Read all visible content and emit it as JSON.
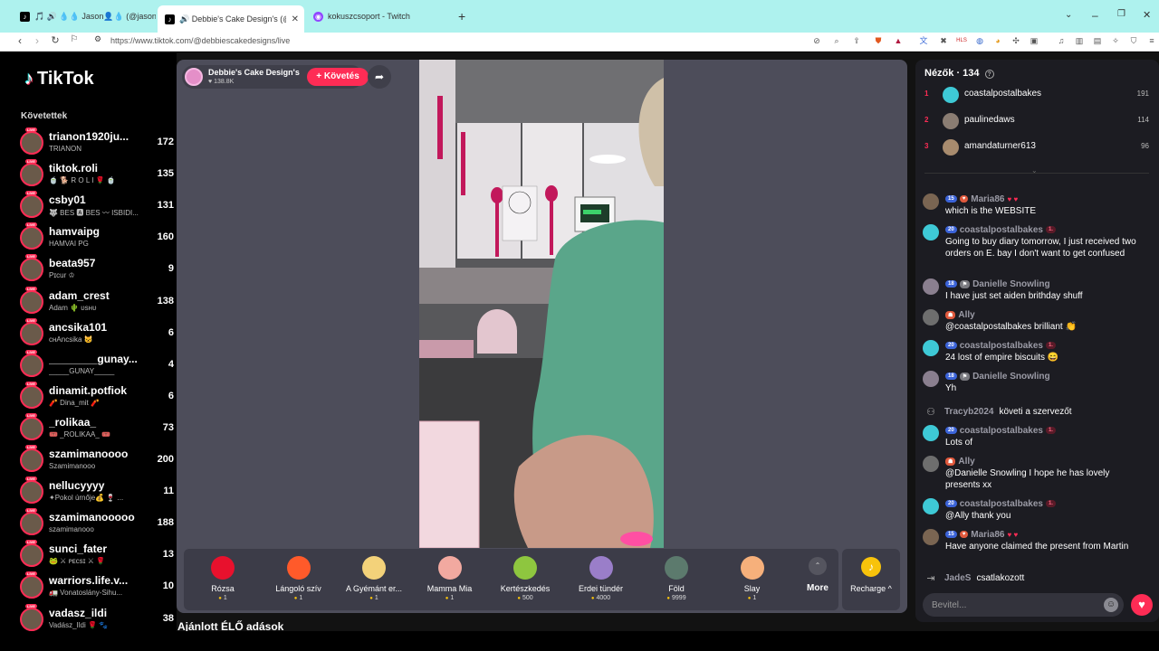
{
  "browser": {
    "tabs": [
      {
        "title": "🎵 🔊 💧💧 Jason👤💧 (@jason_san",
        "color": "#000"
      },
      {
        "title": "🔊 Debbie's Cake Design's (@de",
        "color": "#000"
      },
      {
        "title": "kokuszcsoport - Twitch",
        "color": "#9146ff"
      }
    ],
    "new_tab": "+",
    "url": "https://www.tiktok.com/@debbiescakedesigns/live"
  },
  "sidebar": {
    "logo": "TikTok",
    "following_title": "Követettek",
    "live_badge": "LIVE",
    "items": [
      {
        "name": "trianon1920ju...",
        "sub": "TRIANON",
        "count": "172"
      },
      {
        "name": "tiktok.roli",
        "sub": "🍵 🐕 R O L I 🌹 🍵",
        "count": "135"
      },
      {
        "name": "csby01",
        "sub": "🐺 BES 🅰 BES 〰 ISBIDI...",
        "count": "131"
      },
      {
        "name": "hamvaipg",
        "sub": "HAMVAI PG",
        "count": "160"
      },
      {
        "name": "beata957",
        "sub": "Pɪcur ♔",
        "count": "9"
      },
      {
        "name": "adam_crest",
        "sub": "Adam 🌵 ᴜsʜᴜ",
        "count": "138"
      },
      {
        "name": "ancsika101",
        "sub": "ᴄʜAncsika 😺",
        "count": "6"
      },
      {
        "name": "________gunay...",
        "sub": "_____GUNAY_____",
        "count": "4"
      },
      {
        "name": "dinamit.potfiok",
        "sub": "🧨 Dina_mit 🧨",
        "count": "6"
      },
      {
        "name": "_rolikaa_",
        "sub": "🎟️ _ROLIKAA_ 🎟️",
        "count": "73"
      },
      {
        "name": "szamimanoooo",
        "sub": "Szamimanooo",
        "count": "200"
      },
      {
        "name": "nellucyyyy",
        "sub": "✦Pokol úrnője💰 🍷 ...",
        "count": "11"
      },
      {
        "name": "szamimanooooo",
        "sub": "szamimanooo",
        "count": "188"
      },
      {
        "name": "sunci_fater",
        "sub": "🐸 ⚔ ᴘᴇᴄsɪ ⚔ 🌹",
        "count": "13"
      },
      {
        "name": "warriors.life.v...",
        "sub": "🚛 Vonatoslány-Sihu...",
        "count": "10"
      },
      {
        "name": "vadasz_ildi",
        "sub": "Vadász_Ildi 🌹 🐾",
        "count": "38"
      }
    ]
  },
  "stream": {
    "host_name": "Debbie's Cake Design's",
    "likes": "♥ 138.8K",
    "follow_label": "+ Követés",
    "gifts": [
      {
        "name": "Rózsa",
        "price": "1",
        "color": "#e8112d"
      },
      {
        "name": "Lángoló szív",
        "price": "1",
        "color": "#ff5a2a"
      },
      {
        "name": "A Gyémánt er...",
        "price": "1",
        "color": "#f3d27a"
      },
      {
        "name": "Mamma Mia",
        "price": "1",
        "color": "#f2a9a0"
      },
      {
        "name": "Kertészkedés",
        "price": "500",
        "color": "#8ec63f"
      },
      {
        "name": "Erdei tündér",
        "price": "4000",
        "color": "#9a7ec9"
      },
      {
        "name": "Föld",
        "price": "9999",
        "color": "#5c7a6d"
      },
      {
        "name": "Slay",
        "price": "1",
        "color": "#f6b07b"
      }
    ],
    "more_label": "More",
    "recharge_label": "Recharge ^",
    "recommended_title": "Ajánlott ÉLŐ adások"
  },
  "viewers": {
    "title": "Nézők · 134",
    "top": [
      {
        "rank": "1",
        "name": "coastalpostalbakes",
        "score": "191",
        "color": "#3ec9d6"
      },
      {
        "rank": "2",
        "name": "paulinedaws",
        "score": "114",
        "color": "#8b7d73"
      },
      {
        "rank": "3",
        "name": "amandaturner613",
        "score": "96",
        "color": "#a88b6e"
      }
    ]
  },
  "chat": {
    "messages": [
      {
        "user": "Maria86",
        "level": "15",
        "text": "which is the WEBSITE",
        "color": "#7a6552",
        "badge_type": "heart"
      },
      {
        "user": "coastalpostalbakes",
        "level": "20",
        "text": "Going to buy diary tomorrow, I just received two orders on E. bay I don't want to get confused",
        "color": "#3ec9d6",
        "rank": "1."
      },
      {
        "user": "Danielle Snowling",
        "level": "18",
        "text": "I have just set aiden brithday shuff",
        "color": "#8a7f8f",
        "badge_type": "mod"
      },
      {
        "user": "Ally",
        "level": "",
        "text": "@coastalpostalbakes brilliant 👏",
        "color": "#6e6e6e",
        "badge_type": "fan"
      },
      {
        "user": "coastalpostalbakes",
        "level": "20",
        "text": "24 lost of empire biscuits 😄",
        "color": "#3ec9d6",
        "rank": "1."
      },
      {
        "user": "Danielle Snowling",
        "level": "18",
        "text": "Yh",
        "color": "#8a7f8f",
        "badge_type": "mod"
      },
      {
        "user": "coastalpostalbakes",
        "level": "20",
        "text": "Lots of",
        "color": "#3ec9d6",
        "rank": "1."
      },
      {
        "user": "Ally",
        "level": "",
        "text": "@Danielle Snowling I hope he has lovely presents xx",
        "color": "#6e6e6e",
        "badge_type": "fan"
      },
      {
        "user": "coastalpostalbakes",
        "level": "20",
        "text": "@Ally thank you",
        "color": "#3ec9d6",
        "rank": "1."
      },
      {
        "user": "Maria86",
        "level": "15",
        "text": "Have anyone claimed the present from Martin",
        "color": "#7a6552",
        "badge_type": "heart"
      }
    ],
    "system_follow": {
      "user": "Tracyb2024",
      "action": "követi a szervezőt"
    },
    "system_join": {
      "user": "JadeS",
      "action": "csatlakozott"
    },
    "input_placeholder": "Bevitel..."
  },
  "colors": {
    "accent": "#fe2c55",
    "coin": "#f8c30b"
  }
}
